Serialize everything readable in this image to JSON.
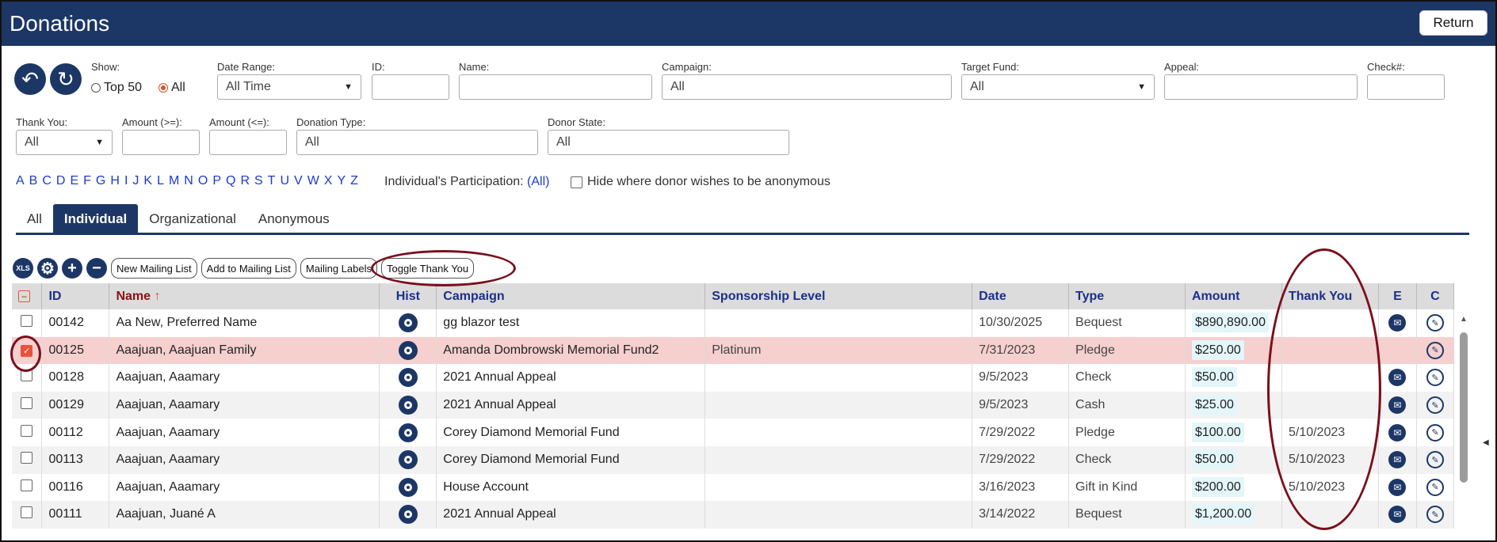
{
  "header": {
    "title": "Donations",
    "return_label": "Return"
  },
  "filters": {
    "show_label": "Show:",
    "show_top50": "Top 50",
    "show_all": "All",
    "date_range_label": "Date Range:",
    "date_range_value": "All Time",
    "id_label": "ID:",
    "name_label": "Name:",
    "campaign_label": "Campaign:",
    "campaign_placeholder": "All",
    "target_fund_label": "Target Fund:",
    "target_fund_value": "All",
    "appeal_label": "Appeal:",
    "check_label": "Check#:",
    "thank_you_label": "Thank You:",
    "thank_you_value": "All",
    "amount_ge_label": "Amount (>=):",
    "amount_le_label": "Amount (<=):",
    "donation_type_label": "Donation Type:",
    "donation_type_placeholder": "All",
    "donor_state_label": "Donor State:",
    "donor_state_placeholder": "All"
  },
  "alphabet": [
    "A",
    "B",
    "C",
    "D",
    "E",
    "F",
    "G",
    "H",
    "I",
    "J",
    "K",
    "L",
    "M",
    "N",
    "O",
    "P",
    "Q",
    "R",
    "S",
    "T",
    "U",
    "V",
    "W",
    "X",
    "Y",
    "Z"
  ],
  "participation": {
    "label": "Individual's Participation:",
    "value": "(All)"
  },
  "hide_anonymous_label": "Hide where donor wishes to be anonymous",
  "tabs": [
    "All",
    "Individual",
    "Organizational",
    "Anonymous"
  ],
  "toolbar": {
    "xls": "XLS",
    "new_mailing_list": "New Mailing List",
    "add_to_mailing_list": "Add to Mailing List",
    "mailing_labels": "Mailing Labels",
    "toggle_thank_you": "Toggle Thank You"
  },
  "table": {
    "columns": [
      "ID",
      "Name",
      "Hist",
      "Campaign",
      "Sponsorship Level",
      "Date",
      "Type",
      "Amount",
      "Thank You",
      "E",
      "C"
    ],
    "sort_arrow": "↑",
    "rows": [
      {
        "id": "00142",
        "name": "Aa New, Preferred Name",
        "campaign": "gg blazor test",
        "sponsorship": "",
        "date": "10/30/2025",
        "type": "Bequest",
        "amount": "$890,890.00",
        "thank_you": "",
        "checked": false,
        "email": true
      },
      {
        "id": "00125",
        "name": "Aaajuan, Aaajuan Family",
        "campaign": "Amanda Dombrowski Memorial Fund2",
        "sponsorship": "Platinum",
        "date": "7/31/2023",
        "type": "Pledge",
        "amount": "$250.00",
        "thank_you": "",
        "checked": true,
        "email": false
      },
      {
        "id": "00128",
        "name": "Aaajuan, Aaamary",
        "campaign": "2021 Annual Appeal",
        "sponsorship": "",
        "date": "9/5/2023",
        "type": "Check",
        "amount": "$50.00",
        "thank_you": "",
        "checked": false,
        "email": true
      },
      {
        "id": "00129",
        "name": "Aaajuan, Aaamary",
        "campaign": "2021 Annual Appeal",
        "sponsorship": "",
        "date": "9/5/2023",
        "type": "Cash",
        "amount": "$25.00",
        "thank_you": "",
        "checked": false,
        "email": true
      },
      {
        "id": "00112",
        "name": "Aaajuan, Aaamary",
        "campaign": "Corey Diamond Memorial Fund",
        "sponsorship": "",
        "date": "7/29/2022",
        "type": "Pledge",
        "amount": "$100.00",
        "thank_you": "5/10/2023",
        "checked": false,
        "email": true
      },
      {
        "id": "00113",
        "name": "Aaajuan, Aaamary",
        "campaign": "Corey Diamond Memorial Fund",
        "sponsorship": "",
        "date": "7/29/2022",
        "type": "Check",
        "amount": "$50.00",
        "thank_you": "5/10/2023",
        "checked": false,
        "email": true
      },
      {
        "id": "00116",
        "name": "Aaajuan, Aaamary",
        "campaign": "House Account",
        "sponsorship": "",
        "date": "3/16/2023",
        "type": "Gift in Kind",
        "amount": "$200.00",
        "thank_you": "5/10/2023",
        "checked": false,
        "email": true
      },
      {
        "id": "00111",
        "name": "Aaajuan, Juané A",
        "campaign": "2021 Annual Appeal",
        "sponsorship": "",
        "date": "3/14/2022",
        "type": "Bequest",
        "amount": "$1,200.00",
        "thank_you": "",
        "checked": false,
        "email": true
      }
    ]
  },
  "colors": {
    "navy": "#1c3766",
    "highlight_row": "#f6cfcf",
    "annotation": "#7a0f1c"
  }
}
